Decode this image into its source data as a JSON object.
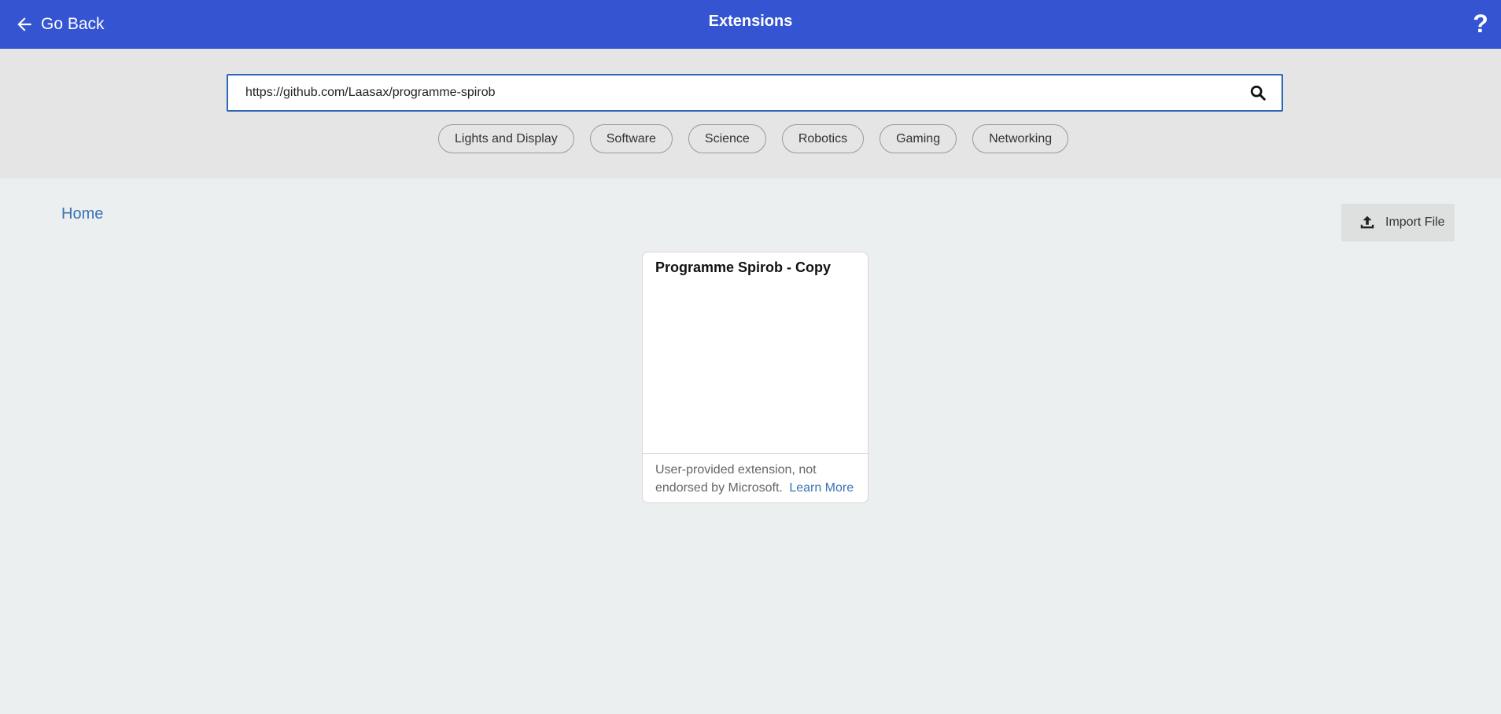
{
  "header": {
    "back_label": "Go Back",
    "title": "Extensions",
    "help": "?"
  },
  "search": {
    "value": "https://github.com/Laasax/programme-spirob",
    "placeholder": ""
  },
  "tags": [
    "Lights and Display",
    "Software",
    "Science",
    "Robotics",
    "Gaming",
    "Networking"
  ],
  "breadcrumb": {
    "home": "Home"
  },
  "import": {
    "label": "Import File"
  },
  "card": {
    "title": "Programme Spirob - Copy",
    "disclaimer": "User-provided extension, not endorsed by Microsoft.",
    "learn_more": "Learn More"
  },
  "colors": {
    "header_bg": "#3454D1",
    "accent": "#2E66B8",
    "link": "#3A72B5"
  },
  "icons": {
    "back": "arrow-left-icon",
    "help": "question-mark-icon",
    "search": "search-icon",
    "import": "upload-icon"
  }
}
